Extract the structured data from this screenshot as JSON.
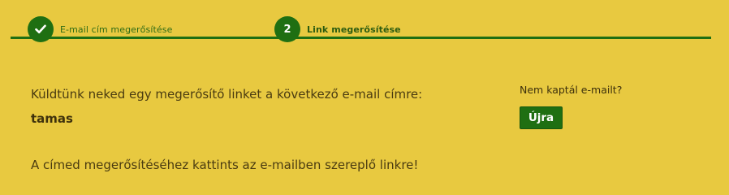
{
  "stepper": {
    "steps": [
      {
        "number": "",
        "icon": "checkmark-icon",
        "label": "E-mail cím megerősítése",
        "status": "completed"
      },
      {
        "number": "2",
        "label": "Link megerősítése",
        "status": "active"
      }
    ]
  },
  "main": {
    "intro": "Küldtünk neked egy megerősítő linket a következő e-mail címre:",
    "email": "tamas",
    "instruction": "A címed megerősítéséhez kattints az e-mailben szereplő linkre!"
  },
  "resend": {
    "question": "Nem kaptál e-mailt?",
    "button_label": "Újra"
  },
  "colors": {
    "background": "#e8c940",
    "accent": "#1f6f12",
    "text": "#4a3b10"
  }
}
